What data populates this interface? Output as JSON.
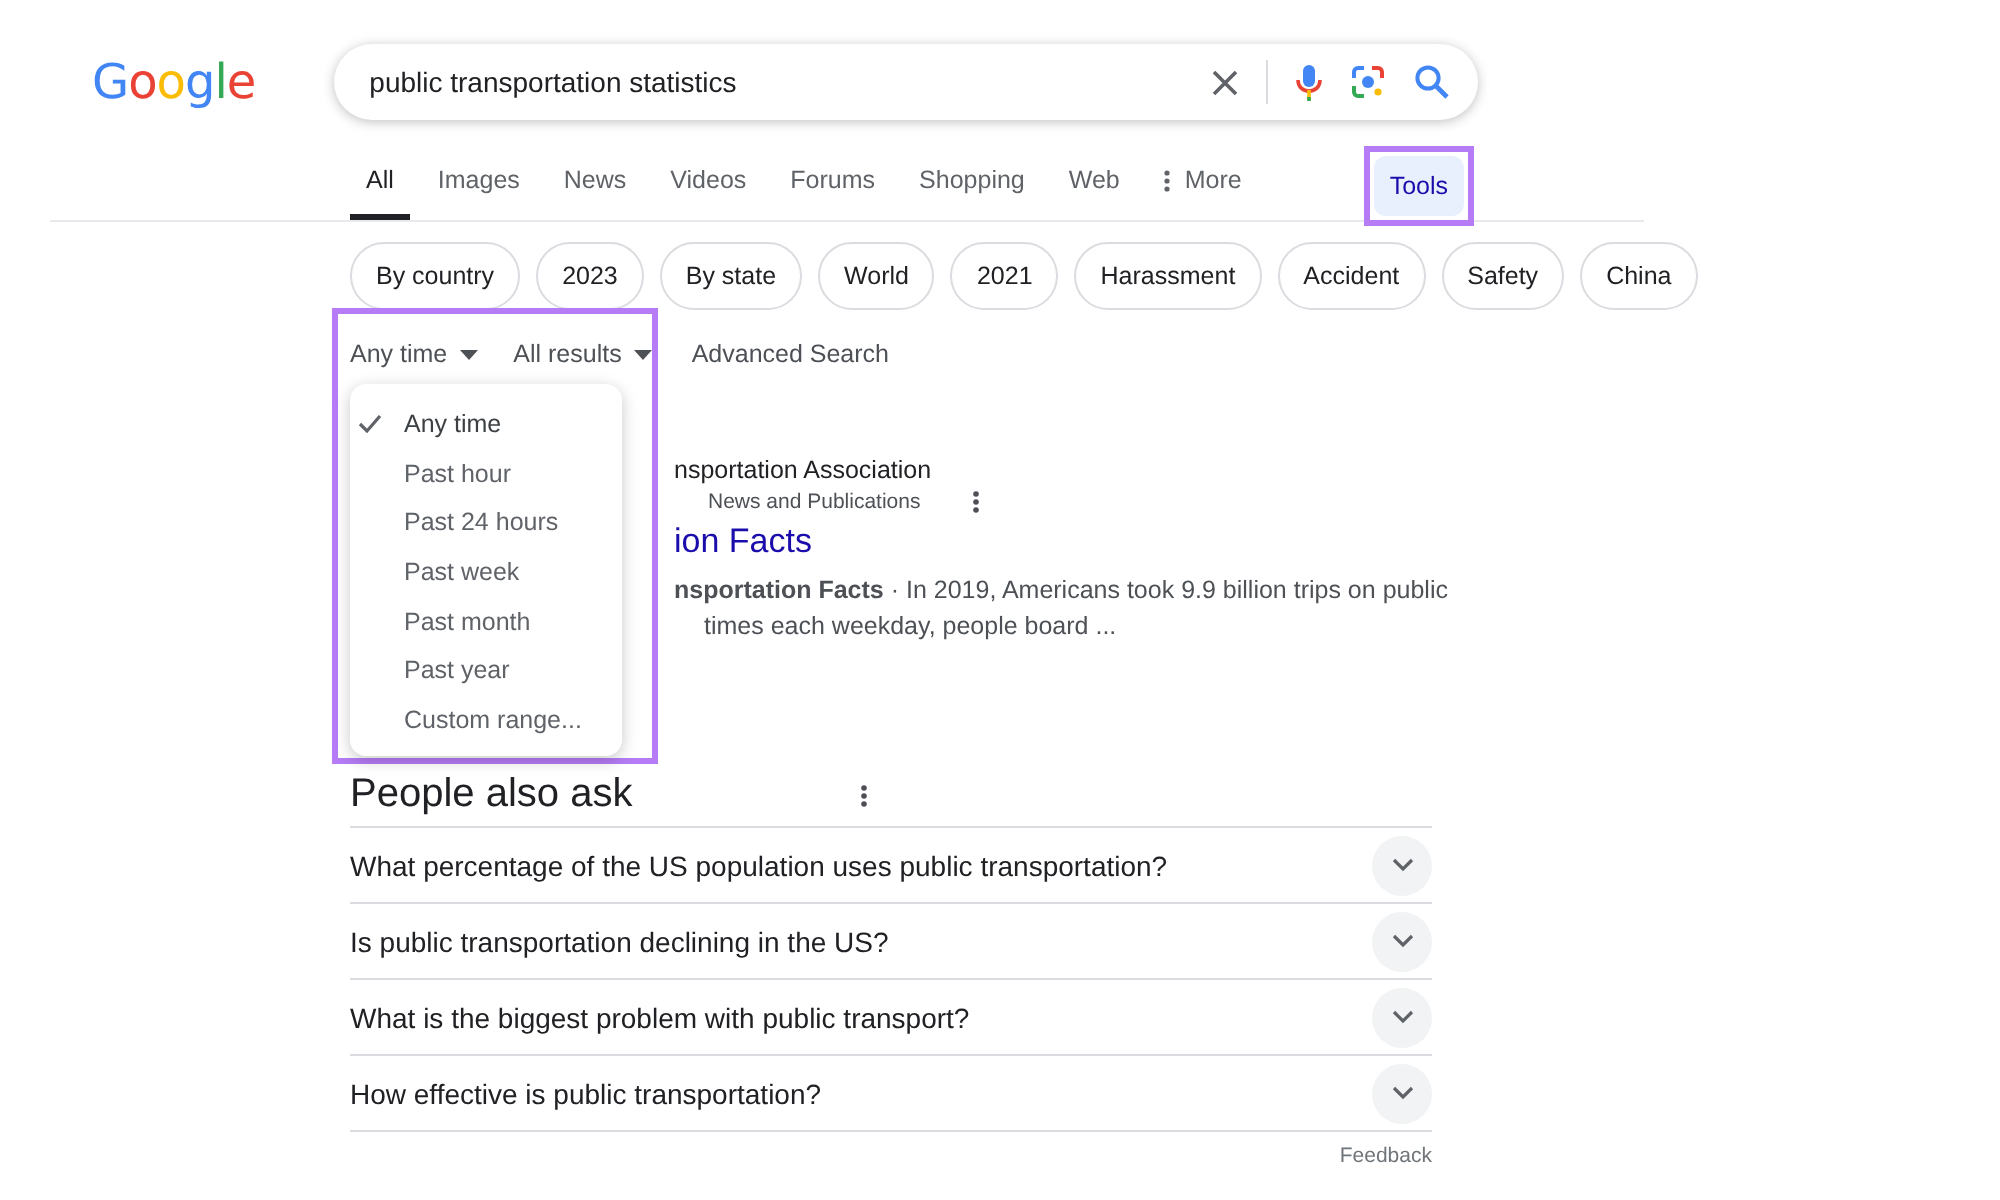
{
  "logo": "Google",
  "search": {
    "value": "public transportation statistics"
  },
  "tabs": [
    {
      "label": "All",
      "selected": true,
      "kind": "tab"
    },
    {
      "label": "Images",
      "selected": false,
      "kind": "tab"
    },
    {
      "label": "News",
      "selected": false,
      "kind": "tab"
    },
    {
      "label": "Videos",
      "selected": false,
      "kind": "tab"
    },
    {
      "label": "Forums",
      "selected": false,
      "kind": "tab"
    },
    {
      "label": "Shopping",
      "selected": false,
      "kind": "tab"
    },
    {
      "label": "Web",
      "selected": false,
      "kind": "tab"
    },
    {
      "label": "More",
      "selected": false,
      "kind": "more"
    }
  ],
  "tools": {
    "label": "Tools",
    "highlighted": true
  },
  "chips": [
    "By country",
    "2023",
    "By state",
    "World",
    "2021",
    "Harassment",
    "Accident",
    "Safety",
    "China"
  ],
  "filters": [
    "Any time",
    "All results"
  ],
  "advanced_search": "Advanced Search",
  "time_menu": {
    "highlighted": true,
    "options": [
      {
        "label": "Any time",
        "selected": true
      },
      {
        "label": "Past hour",
        "selected": false
      },
      {
        "label": "Past 24 hours",
        "selected": false
      },
      {
        "label": "Past week",
        "selected": false
      },
      {
        "label": "Past month",
        "selected": false
      },
      {
        "label": "Past year",
        "selected": false
      },
      {
        "label": "Custom range...",
        "selected": false
      }
    ]
  },
  "result": {
    "site": "nsportation Association",
    "breadcrumb": "News and Publications",
    "title": "ion Facts",
    "snippet_lines": [
      "**nsportation Facts** · In 2019, Americans took 9.9 billion trips on public",
      "times each weekday, people board ..."
    ]
  },
  "people_also_ask": {
    "heading": "People also ask",
    "questions": [
      "What percentage of the US population uses public transportation?",
      "Is public transportation declining in the US?",
      "What is the biggest problem with public transport?",
      "How effective is public transportation?"
    ]
  },
  "feedback": "Feedback"
}
